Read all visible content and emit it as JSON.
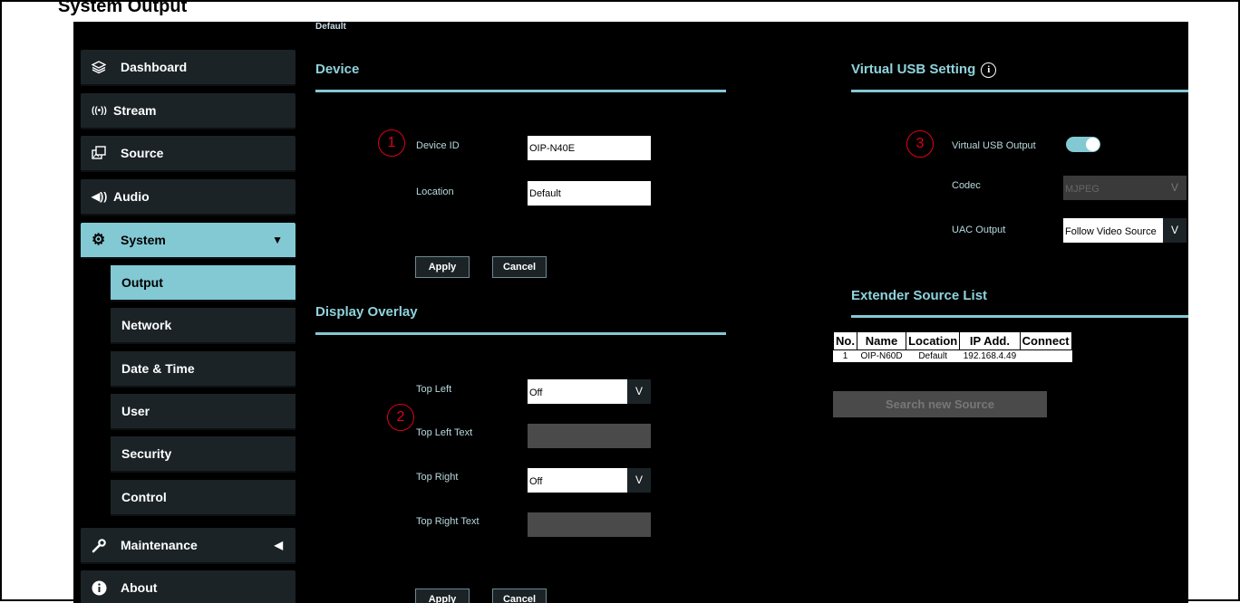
{
  "header_text": "System Output",
  "breadcrumb": "Default",
  "sidebar": {
    "items": [
      {
        "label": "Dashboard",
        "icon": "layers-icon"
      },
      {
        "label": "Stream",
        "icon": "broadcast-icon"
      },
      {
        "label": "Source",
        "icon": "source-icon"
      },
      {
        "label": "Audio",
        "icon": "speaker-icon"
      },
      {
        "label": "System",
        "icon": "gear-icon",
        "arrow": "▼"
      },
      {
        "label": "Maintenance",
        "icon": "wrench-icon",
        "arrow": "◀"
      },
      {
        "label": "About",
        "icon": "info-icon"
      }
    ],
    "system_subitems": [
      "Output",
      "Network",
      "Date & Time",
      "User",
      "Security",
      "Control"
    ],
    "active_subitem": "Output"
  },
  "device": {
    "title": "Device",
    "device_id_label": "Device ID",
    "device_id_value": "OIP-N40E",
    "location_label": "Location",
    "location_value": "Default",
    "apply_label": "Apply",
    "cancel_label": "Cancel"
  },
  "overlay": {
    "title": "Display Overlay",
    "top_left_label": "Top Left",
    "top_left_value": "Off",
    "top_left_text_label": "Top Left Text",
    "top_left_text_value": "",
    "top_right_label": "Top Right",
    "top_right_value": "Off",
    "top_right_text_label": "Top Right Text",
    "top_right_text_value": "",
    "apply_label": "Apply",
    "cancel_label": "Cancel"
  },
  "usb": {
    "title": "Virtual USB Setting",
    "info_glyph": "i",
    "output_label": "Virtual USB Output",
    "output_enabled": true,
    "codec_label": "Codec",
    "codec_value": "MJPEG",
    "uac_label": "UAC Output",
    "uac_value": "Follow Video Source",
    "dropdown_glyph": "V"
  },
  "extender": {
    "title": "Extender Source List",
    "columns": [
      "No.",
      "Name",
      "Location",
      "IP Add.",
      "Connect"
    ],
    "rows": [
      [
        "1",
        "OIP-N60D",
        "Default",
        "192.168.4.49",
        ""
      ]
    ],
    "search_label": "Search new Source"
  },
  "markers": [
    "1",
    "2",
    "3"
  ],
  "colors": {
    "accent": "#83c9d4",
    "background": "#000000",
    "nav_bg": "#1b2326",
    "marker": "#e0001a"
  }
}
